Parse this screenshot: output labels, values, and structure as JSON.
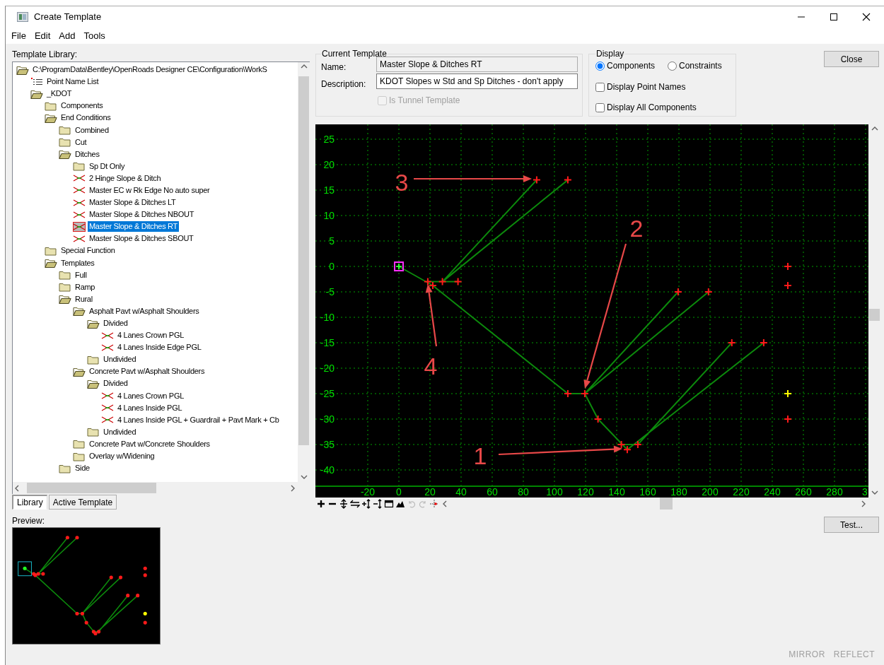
{
  "window": {
    "title": "Create Template"
  },
  "menu": [
    "File",
    "Edit",
    "Add",
    "Tools"
  ],
  "template_library": {
    "label": "Template Library:",
    "tree": [
      {
        "label": "C:\\ProgramData\\Bentley\\OpenRoads Designer CE\\Configuration\\WorkS",
        "kind": "folder",
        "expanded": true,
        "selected": false,
        "children": [
          {
            "label": "Point Name List",
            "kind": "list",
            "selected": false
          },
          {
            "label": "_KDOT",
            "kind": "folder",
            "expanded": true,
            "selected": false,
            "children": [
              {
                "label": "Components",
                "kind": "folder",
                "expanded": false,
                "selected": false
              },
              {
                "label": "End Conditions",
                "kind": "folder",
                "expanded": true,
                "selected": false,
                "children": [
                  {
                    "label": "Combined",
                    "kind": "folder",
                    "expanded": false,
                    "selected": false
                  },
                  {
                    "label": "Cut",
                    "kind": "folder",
                    "expanded": false,
                    "selected": false
                  },
                  {
                    "label": "Ditches",
                    "kind": "folder",
                    "expanded": true,
                    "selected": false,
                    "children": [
                      {
                        "label": "Sp Dt Only",
                        "kind": "folder",
                        "expanded": false,
                        "selected": false
                      },
                      {
                        "label": "2 Hinge Slope & Ditch",
                        "kind": "template",
                        "selected": false
                      },
                      {
                        "label": "Master EC w Rk Edge No auto super",
                        "kind": "template",
                        "selected": false
                      },
                      {
                        "label": "Master Slope & Ditches LT",
                        "kind": "template",
                        "selected": false
                      },
                      {
                        "label": "Master Slope & Ditches NBOUT",
                        "kind": "template",
                        "selected": false
                      },
                      {
                        "label": "Master Slope & Ditches RT",
                        "kind": "template",
                        "selected": true
                      },
                      {
                        "label": "Master Slope & Ditches SBOUT",
                        "kind": "template",
                        "selected": false
                      }
                    ]
                  }
                ]
              },
              {
                "label": "Special Function",
                "kind": "folder",
                "expanded": false,
                "selected": false
              },
              {
                "label": "Templates",
                "kind": "folder",
                "expanded": true,
                "selected": false,
                "children": [
                  {
                    "label": "Full",
                    "kind": "folder",
                    "expanded": false,
                    "selected": false
                  },
                  {
                    "label": "Ramp",
                    "kind": "folder",
                    "expanded": false,
                    "selected": false
                  },
                  {
                    "label": "Rural",
                    "kind": "folder",
                    "expanded": true,
                    "selected": false,
                    "children": [
                      {
                        "label": "Asphalt Pavt w/Asphalt Shoulders",
                        "kind": "folder",
                        "expanded": true,
                        "selected": false,
                        "children": [
                          {
                            "label": "Divided",
                            "kind": "folder",
                            "expanded": true,
                            "selected": false,
                            "children": [
                              {
                                "label": "4 Lanes Crown PGL",
                                "kind": "template",
                                "selected": false
                              },
                              {
                                "label": "4 Lanes Inside Edge PGL",
                                "kind": "template",
                                "selected": false
                              }
                            ]
                          },
                          {
                            "label": "Undivided",
                            "kind": "folder",
                            "expanded": false,
                            "selected": false
                          }
                        ]
                      },
                      {
                        "label": "Concrete Pavt w/Asphalt Shoulders",
                        "kind": "folder",
                        "expanded": true,
                        "selected": false,
                        "children": [
                          {
                            "label": "Divided",
                            "kind": "folder",
                            "expanded": true,
                            "selected": false,
                            "children": [
                              {
                                "label": "4 Lanes Crown PGL",
                                "kind": "template",
                                "selected": false
                              },
                              {
                                "label": "4 Lanes Inside PGL",
                                "kind": "template",
                                "selected": false
                              },
                              {
                                "label": "4 Lanes Inside PGL + Guardrail + Pavt Mark + Cb",
                                "kind": "template",
                                "selected": false
                              }
                            ]
                          },
                          {
                            "label": "Undivided",
                            "kind": "folder",
                            "expanded": false,
                            "selected": false
                          }
                        ]
                      },
                      {
                        "label": "Concrete Pavt w/Concrete Shoulders",
                        "kind": "folder",
                        "expanded": false,
                        "selected": false
                      },
                      {
                        "label": "Overlay w/Widening",
                        "kind": "folder",
                        "expanded": false,
                        "selected": false
                      }
                    ]
                  },
                  {
                    "label": "Side",
                    "kind": "folder",
                    "expanded": false,
                    "selected": false
                  }
                ]
              }
            ]
          }
        ]
      }
    ]
  },
  "library_tabs": [
    {
      "label": "Library",
      "selected": true
    },
    {
      "label": "Active Template",
      "selected": false
    }
  ],
  "preview": {
    "label": "Preview:"
  },
  "current_template": {
    "title": "Current Template",
    "name": {
      "label": "Name:",
      "value": "Master Slope & Ditches RT",
      "readonly": true
    },
    "description": {
      "label": "Description:",
      "value": "KDOT Slopes w Std and Sp Ditches - don't apply",
      "readonly": false
    },
    "tunnel": {
      "label": "Is Tunnel Template",
      "checked": false,
      "disabled": true
    }
  },
  "display": {
    "title": "Display",
    "modes": [
      {
        "label": "Components",
        "selected": true
      },
      {
        "label": "Constraints",
        "selected": false
      }
    ],
    "options": [
      {
        "label": "Display Point Names",
        "checked": false
      },
      {
        "label": "Display All Components",
        "checked": false
      }
    ]
  },
  "close_button": "Close",
  "canvas": {
    "y_labels": [
      "25",
      "20",
      "15",
      "10",
      "5",
      "0",
      "-5",
      "-10",
      "-15",
      "-20",
      "-25",
      "-30",
      "-35",
      "-40"
    ],
    "x_labels": [
      "-20",
      "0",
      "20",
      "40",
      "60",
      "80",
      "100",
      "120",
      "140",
      "160",
      "180",
      "200",
      "220",
      "240",
      "260",
      "280",
      "3"
    ],
    "callouts": [
      {
        "label": "3"
      },
      {
        "label": "2"
      },
      {
        "label": "4"
      },
      {
        "label": "1"
      }
    ]
  },
  "test_button": "Test...",
  "footer": [
    {
      "label": "MIRROR",
      "disabled": true
    },
    {
      "label": "REFLECT",
      "disabled": true
    }
  ]
}
